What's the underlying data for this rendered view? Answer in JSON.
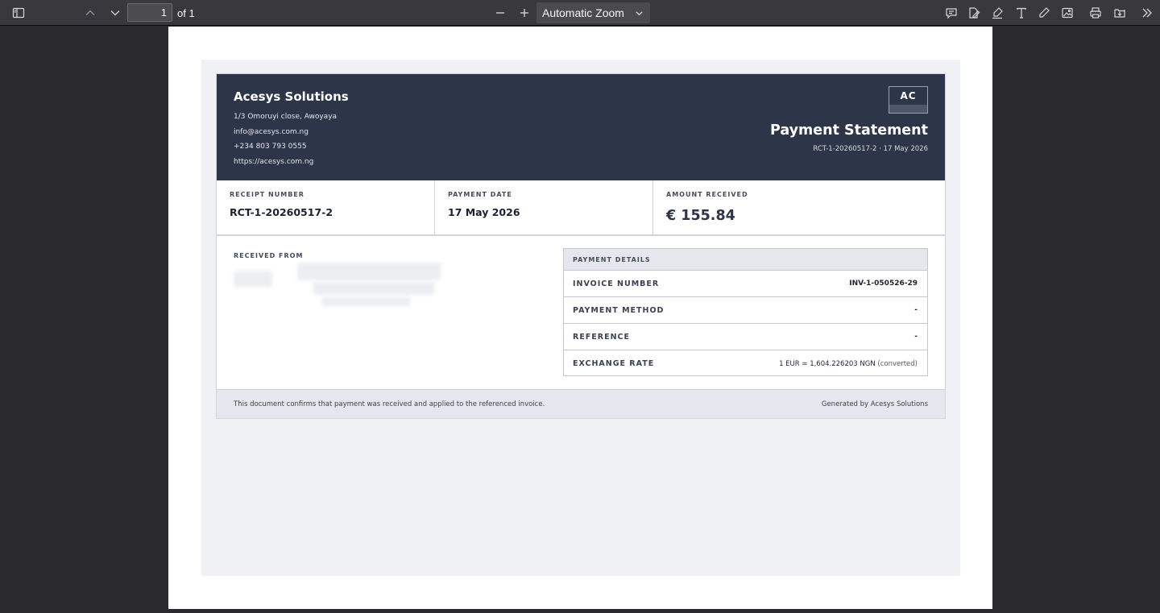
{
  "toolbar": {
    "page_number": "1",
    "page_count_label": "of 1",
    "zoom_value": "Automatic Zoom",
    "icons": [
      "sidebar-toggle-icon",
      "chevron-up-icon",
      "chevron-down-icon",
      "minus-icon",
      "plus-icon",
      "comment-icon",
      "signature-icon",
      "highlight-icon",
      "text-icon",
      "draw-icon",
      "image-icon",
      "print-icon",
      "save-icon",
      "tools-icon"
    ]
  },
  "document": {
    "company_name": "Acesys Solutions",
    "address": "1/3 Omoruyi close, Awoyaya",
    "email": "info@acesys.com.ng",
    "phone": "+234 803 793 0555",
    "website": "https://acesys.com.ng",
    "logo_initials": "AC",
    "title": "Payment Statement",
    "subtitle": "RCT-1-20260517-2 · 17 May 2026",
    "summary": {
      "receipt_number_label": "RECEIPT NUMBER",
      "receipt_number": "RCT-1-20260517-2",
      "payment_date_label": "PAYMENT DATE",
      "payment_date": "17 May 2026",
      "amount_received_label": "AMOUNT RECEIVED",
      "amount_received": "€ 155.84"
    },
    "received_from_label": "RECEIVED FROM",
    "payment_details": {
      "heading": "PAYMENT DETAILS",
      "invoice_number_label": "INVOICE NUMBER",
      "invoice_number": "INV-1-050526-29",
      "payment_method_label": "PAYMENT METHOD",
      "payment_method": "-",
      "reference_label": "REFERENCE",
      "reference": "-",
      "exchange_rate_label": "EXCHANGE RATE",
      "exchange_rate": "1 EUR = 1,604.226203 NGN",
      "exchange_rate_note": "(converted)"
    },
    "footer_note": "This document confirms that payment was received and applied to the referenced invoice.",
    "footer_generated": "Generated by Acesys Solutions"
  },
  "colors": {
    "toolbar_bg": "#38383d",
    "viewer_bg": "#2a2a2e",
    "header_bg": "#2d3548",
    "panel_bg": "#f0f1f5"
  }
}
